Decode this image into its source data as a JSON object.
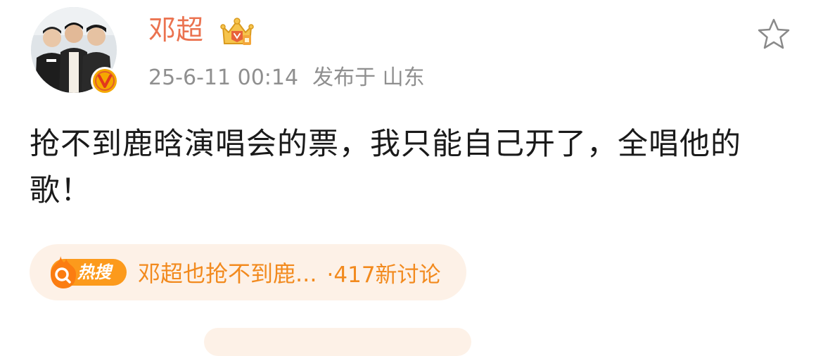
{
  "post": {
    "author": {
      "name": "邓超",
      "avatar": "group-photo-avatar",
      "badge": "verified-v-icon",
      "vip_icon": "crown-icon"
    },
    "timestamp": "25-6-11 00:14",
    "location": "发布于 山东",
    "text": "抢不到鹿晗演唱会的票，我只能自己开了，全唱他的歌！",
    "favorite_icon": "star-icon"
  },
  "hot_search": {
    "label": "热搜",
    "title": "邓超也抢不到鹿...",
    "count": "·417新讨论",
    "icon": "search-icon"
  },
  "colors": {
    "name": "#eb7350",
    "meta": "#8f8f8f",
    "text": "#1a1a1a",
    "hot_text": "#f28a1e",
    "hot_background": "#fdf1e7",
    "verified": "#f5a800"
  }
}
